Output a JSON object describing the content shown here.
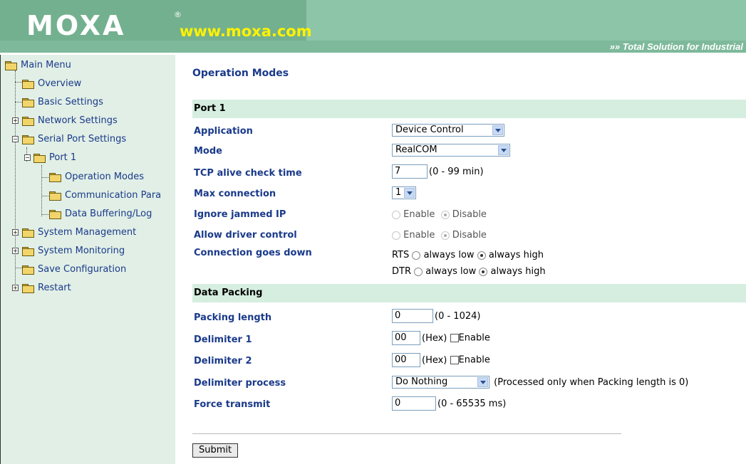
{
  "header": {
    "logo": "MOXA",
    "registered": "®",
    "url": "www.moxa.com",
    "tagline": "»» Total Solution for Industrial"
  },
  "sidebar": {
    "items": [
      {
        "label": "Main Menu"
      },
      {
        "label": "Overview"
      },
      {
        "label": "Basic Settings"
      },
      {
        "label": "Network Settings"
      },
      {
        "label": "Serial Port Settings"
      },
      {
        "label": "Port 1"
      },
      {
        "label": "Operation Modes"
      },
      {
        "label": "Communication Para"
      },
      {
        "label": "Data Buffering/Log"
      },
      {
        "label": "System Management"
      },
      {
        "label": "System Monitoring"
      },
      {
        "label": "Save Configuration"
      },
      {
        "label": "Restart"
      }
    ]
  },
  "main": {
    "title": "Operation Modes",
    "port_section": "Port 1",
    "packing_section": "Data Packing",
    "fields": {
      "application": {
        "label": "Application",
        "value": "Device Control"
      },
      "mode": {
        "label": "Mode",
        "value": "RealCOM"
      },
      "tcp_alive": {
        "label": "TCP alive check time",
        "value": "7",
        "hint": "(0 - 99 min)"
      },
      "max_connection": {
        "label": "Max connection",
        "value": "1"
      },
      "ignore_jammed": {
        "label": "Ignore jammed IP",
        "opt1": "Enable",
        "opt2": "Disable"
      },
      "allow_driver": {
        "label": "Allow driver control",
        "opt1": "Enable",
        "opt2": "Disable"
      },
      "connection_down": {
        "label": "Connection goes down",
        "rts": "RTS",
        "dtr": "DTR",
        "low": "always low",
        "high": "always high"
      },
      "packing_length": {
        "label": "Packing length",
        "value": "0",
        "hint": "(0 - 1024)"
      },
      "delimiter1": {
        "label": "Delimiter 1",
        "value": "00",
        "hex": "(Hex)",
        "enable": "Enable"
      },
      "delimiter2": {
        "label": "Delimiter 2",
        "value": "00",
        "hex": "(Hex)",
        "enable": "Enable"
      },
      "delimiter_process": {
        "label": "Delimiter process",
        "value": "Do Nothing",
        "hint": "(Processed only when Packing length is 0)"
      },
      "force_transmit": {
        "label": "Force transmit",
        "value": "0",
        "hint": "(0 - 65535 ms)"
      }
    },
    "submit_label": "Submit"
  }
}
